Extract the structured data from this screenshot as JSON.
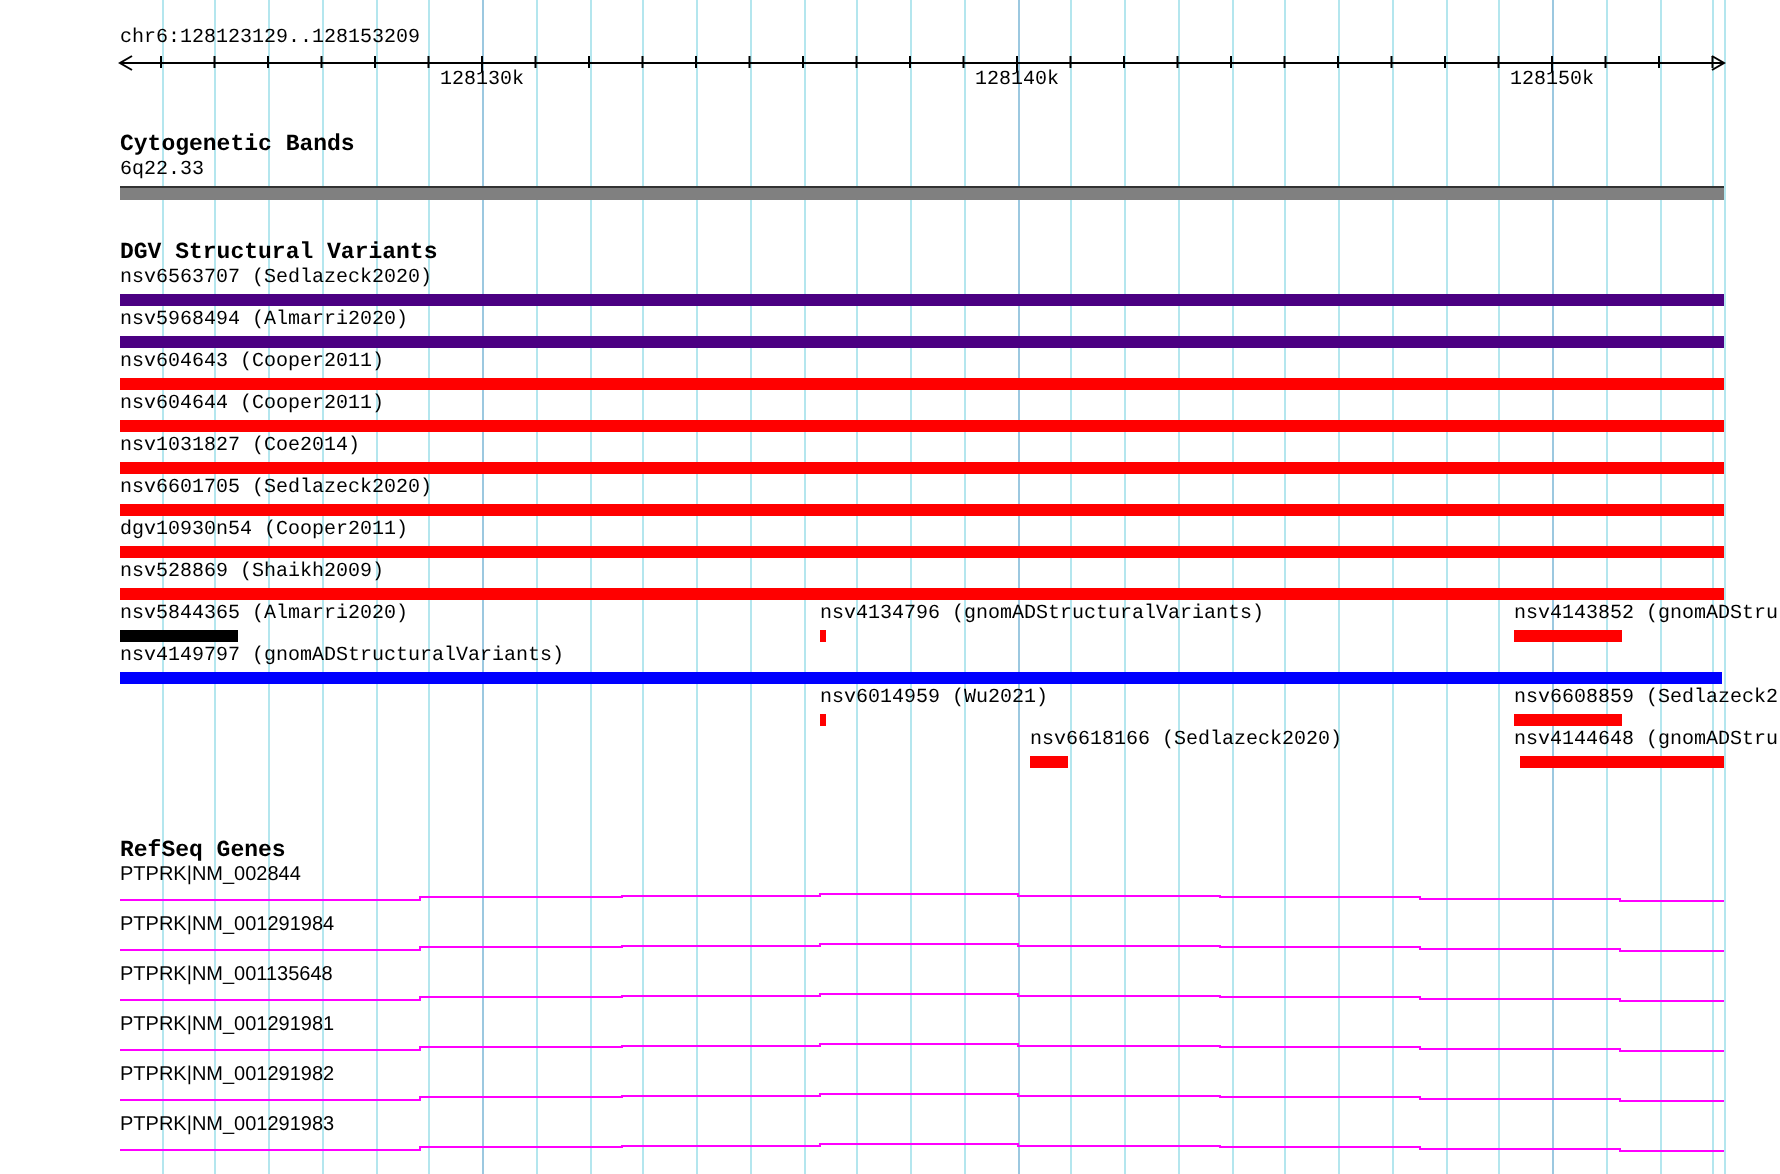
{
  "ruler": {
    "location": "chr6:128123129..128153209",
    "ticks": [
      "128130k",
      "128140k",
      "128150k"
    ]
  },
  "cytogenetic_bands": {
    "title": "Cytogenetic Bands",
    "bands": [
      {
        "label": "6q22.33",
        "color": "#808080"
      }
    ]
  },
  "dgv_structural_variants": {
    "title": "DGV Structural Variants",
    "rows": [
      {
        "features": [
          {
            "label": "nsv6563707 (Sedlazeck2020)",
            "color": "#4b0082"
          }
        ]
      },
      {
        "features": [
          {
            "label": "nsv5968494 (Almarri2020)",
            "color": "#4b0082"
          }
        ]
      },
      {
        "features": [
          {
            "label": "nsv604643 (Cooper2011)",
            "color": "#ff0000"
          }
        ]
      },
      {
        "features": [
          {
            "label": "nsv604644 (Cooper2011)",
            "color": "#ff0000"
          }
        ]
      },
      {
        "features": [
          {
            "label": "nsv1031827 (Coe2014)",
            "color": "#ff0000"
          }
        ]
      },
      {
        "features": [
          {
            "label": "nsv6601705 (Sedlazeck2020)",
            "color": "#ff0000"
          }
        ]
      },
      {
        "features": [
          {
            "label": "dgv10930n54 (Cooper2011)",
            "color": "#ff0000"
          }
        ]
      },
      {
        "features": [
          {
            "label": "nsv528869 (Shaikh2009)",
            "color": "#ff0000"
          }
        ]
      },
      {
        "features": [
          {
            "label": "nsv5844365 (Almarri2020)",
            "color": "#000000"
          },
          {
            "label": "nsv4134796 (gnomADStructuralVariants)",
            "color": "#ff0000"
          },
          {
            "label": "nsv4143852 (gnomADStru",
            "color": "#ff0000"
          }
        ]
      },
      {
        "features": [
          {
            "label": "nsv4149797 (gnomADStructuralVariants)",
            "color": "#0000ff"
          }
        ]
      },
      {
        "features": [
          {
            "label": "nsv6014959 (Wu2021)",
            "color": "#ff0000"
          },
          {
            "label": "nsv6608859 (Sedlazeck2",
            "color": "#ff0000"
          }
        ]
      },
      {
        "features": [
          {
            "label": "nsv6618166 (Sedlazeck2020)",
            "color": "#ff0000"
          },
          {
            "label": "nsv4144648 (gnomADStru",
            "color": "#ff0000"
          }
        ]
      }
    ]
  },
  "refseq_genes": {
    "title": "RefSeq Genes",
    "genes": [
      {
        "label": "PTPRK|NM_002844"
      },
      {
        "label": "PTPRK|NM_001291984"
      },
      {
        "label": "PTPRK|NM_001135648"
      },
      {
        "label": "PTPRK|NM_001291981"
      },
      {
        "label": "PTPRK|NM_001291982"
      },
      {
        "label": "PTPRK|NM_001291983"
      }
    ]
  }
}
